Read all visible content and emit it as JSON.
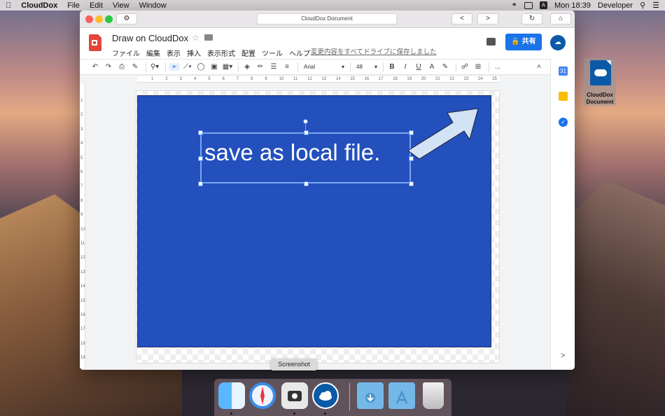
{
  "menubar": {
    "app_name": "CloudDox",
    "items": [
      "File",
      "Edit",
      "View",
      "Window"
    ],
    "clock": "Mon 18:39",
    "user": "Developer",
    "input_badge": "A"
  },
  "window": {
    "title": "CloudDox Document",
    "nav_back": "<",
    "nav_forward": ">",
    "settings_icon": "gear-icon",
    "refresh_icon": "refresh-icon",
    "home_icon": "home-icon"
  },
  "doc": {
    "title": "Draw on CloudDox",
    "menus": [
      "ファイル",
      "編集",
      "表示",
      "挿入",
      "表示形式",
      "配置",
      "ツール",
      "ヘルプ"
    ],
    "save_status": "変更内容をすべてドライブに保存しました",
    "share_label": "共有",
    "share_icon": "lock-icon"
  },
  "toolbar": {
    "font": "Arial",
    "size": "48",
    "bold": "B",
    "italic": "I",
    "underline": "U",
    "text_color": "A",
    "more": "..."
  },
  "ruler": {
    "h_ticks": [
      "1",
      "2",
      "3",
      "4",
      "5",
      "6",
      "7",
      "8",
      "9",
      "10",
      "11",
      "12",
      "13",
      "14",
      "15",
      "16",
      "17",
      "18",
      "19",
      "20",
      "21",
      "22",
      "23",
      "24",
      "25"
    ],
    "v_ticks": [
      "1",
      "2",
      "3",
      "4",
      "5",
      "6",
      "7",
      "8",
      "9",
      "10",
      "11",
      "12",
      "13",
      "14",
      "15",
      "16",
      "17",
      "18",
      "19"
    ]
  },
  "canvas": {
    "textbox_text": "save as local file.",
    "slide_color": "#2450bd",
    "arrow_color": "#d3e3f6"
  },
  "side_panel": {
    "calendar_label": "31",
    "collapse": ">"
  },
  "desktop_icon": {
    "label_line1": "CloudDox",
    "label_line2": "Document"
  },
  "dock": {
    "tooltip": "Screenshot",
    "items": [
      "finder-icon",
      "safari-icon",
      "screenshot-icon",
      "clouddox-icon",
      "downloads-folder-icon",
      "applications-folder-icon",
      "trash-icon"
    ]
  }
}
